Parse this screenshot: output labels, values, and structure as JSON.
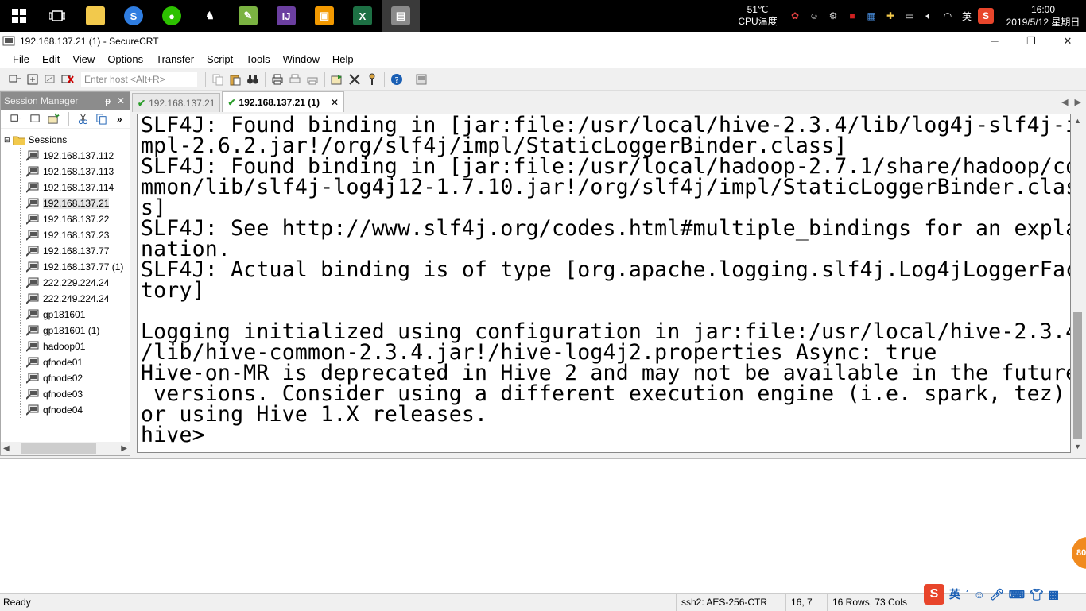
{
  "taskbar": {
    "cpu_temp": "51℃",
    "cpu_label": "CPU温度",
    "ime_mode": "英",
    "time": "16:00",
    "date": "2019/5/12 星期日"
  },
  "window": {
    "title": "192.168.137.21 (1) - SecureCRT",
    "minimize": "─",
    "restore": "❐",
    "close": "✕"
  },
  "menu": [
    "File",
    "Edit",
    "View",
    "Options",
    "Transfer",
    "Script",
    "Tools",
    "Window",
    "Help"
  ],
  "toolbar": {
    "host_placeholder": "Enter host <Alt+R>"
  },
  "session_manager": {
    "title": "Session Manager",
    "pin": "ᵽ",
    "close": "✕",
    "root": "Sessions",
    "items": [
      "192.168.137.112",
      "192.168.137.113",
      "192.168.137.114",
      "192.168.137.21",
      "192.168.137.22",
      "192.168.137.23",
      "192.168.137.77",
      "192.168.137.77 (1)",
      "222.229.224.24",
      "222.249.224.24",
      "gp181601",
      "gp181601 (1)",
      "hadoop01",
      "qfnode01",
      "qfnode02",
      "qfnode03",
      "qfnode04"
    ],
    "selected": "192.168.137.21"
  },
  "tabs": [
    {
      "label": "192.168.137.21",
      "active": false
    },
    {
      "label": "192.168.137.21 (1)",
      "active": true
    }
  ],
  "terminal": {
    "lines": [
      "SLF4J: Found binding in [jar:file:/usr/local/hive-2.3.4/lib/log4j-slf4j-i",
      "mpl-2.6.2.jar!/org/slf4j/impl/StaticLoggerBinder.class]",
      "SLF4J: Found binding in [jar:file:/usr/local/hadoop-2.7.1/share/hadoop/co",
      "mmon/lib/slf4j-log4j12-1.7.10.jar!/org/slf4j/impl/StaticLoggerBinder.clas",
      "s]",
      "SLF4J: See http://www.slf4j.org/codes.html#multiple_bindings for an expla",
      "nation.",
      "SLF4J: Actual binding is of type [org.apache.logging.slf4j.Log4jLoggerFac",
      "tory]",
      "",
      "Logging initialized using configuration in jar:file:/usr/local/hive-2.3.4",
      "/lib/hive-common-2.3.4.jar!/hive-log4j2.properties Async: true",
      "Hive-on-MR is deprecated in Hive 2 and may not be available in the future",
      " versions. Consider using a different execution engine (i.e. spark, tez)",
      "or using Hive 1.X releases.",
      "hive>"
    ]
  },
  "statusbar": {
    "ready": "Ready",
    "cipher": "ssh2: AES-256-CTR",
    "cursor": "16,   7",
    "size": "16 Rows, 73 Cols"
  },
  "ime": {
    "logo": "S",
    "mode": "英"
  },
  "float_badge": "80",
  "colors": {
    "taskbar_bg": "#000000",
    "session_header_bg": "#8c8c8c",
    "tab_check": "#2a9d2a",
    "ime_red": "#e8452b"
  }
}
